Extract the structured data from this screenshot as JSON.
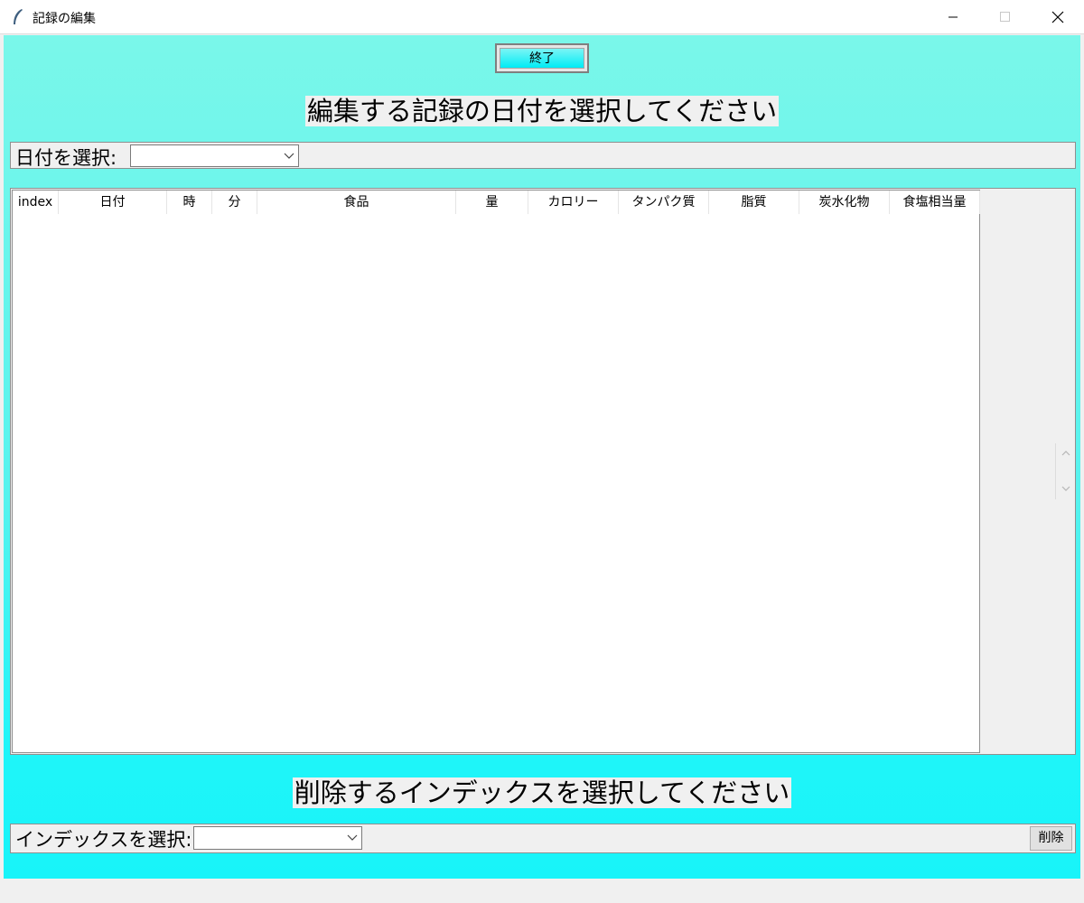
{
  "window": {
    "title": "記録の編集",
    "app_icon": "feather-icon",
    "controls": [
      "minimize-icon",
      "maximize-icon",
      "close-icon"
    ]
  },
  "toolbar": {
    "exit_label": "終了"
  },
  "date_section": {
    "heading": "編集する記録の日付を選択してください",
    "select_label": "日付を選択:",
    "selected_value": ""
  },
  "table": {
    "columns": [
      "index",
      "日付",
      "時",
      "分",
      "食品",
      "量",
      "カロリー",
      "タンパク質",
      "脂質",
      "炭水化物",
      "食塩相当量"
    ],
    "rows": []
  },
  "delete_section": {
    "heading": "削除するインデックスを選択してください",
    "select_label": "インデックスを選択:",
    "selected_value": "",
    "delete_label": "削除"
  },
  "colors": {
    "background_top": "#7af7ea",
    "background_bottom": "#18f4f9",
    "exit_button": "#00ecf5"
  }
}
